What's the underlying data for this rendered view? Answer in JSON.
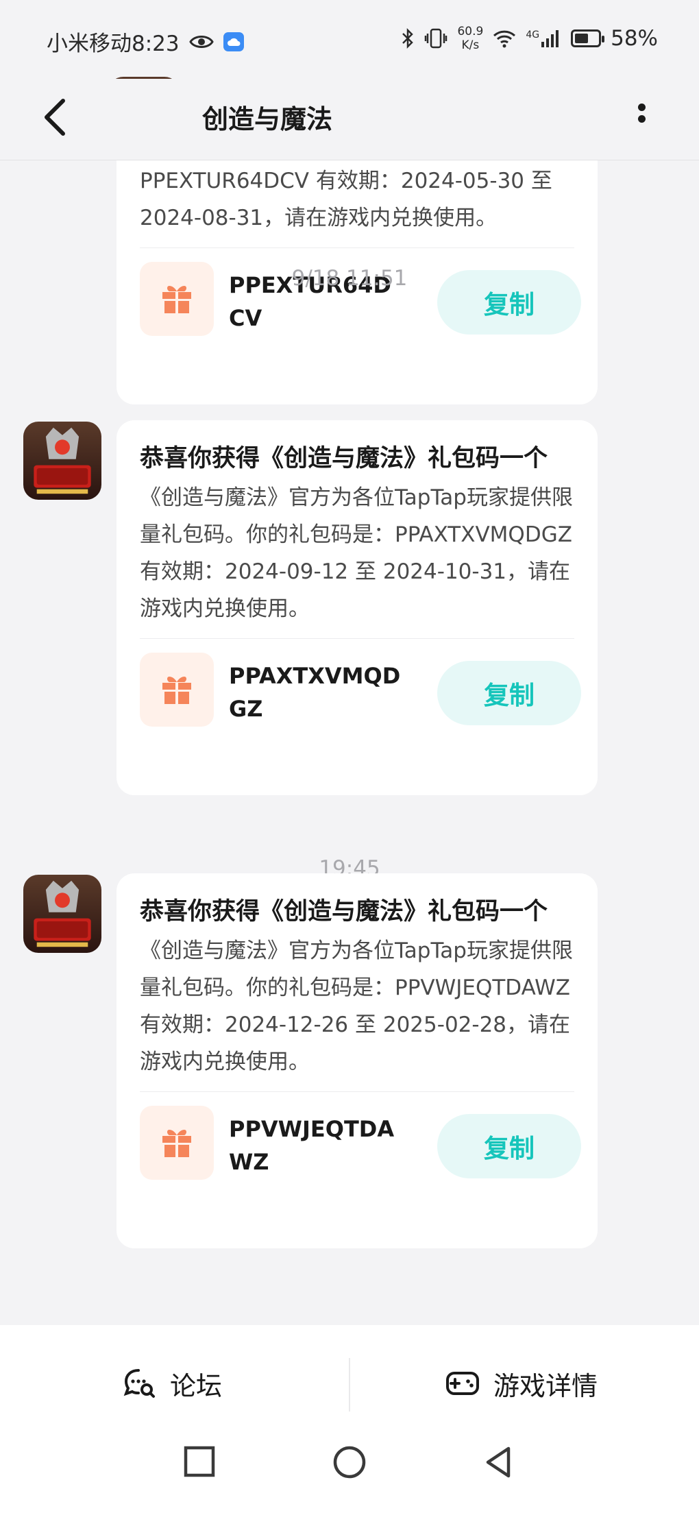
{
  "status_bar": {
    "carrier_time": "小米移动8:23",
    "speed_value": "60.9",
    "speed_unit": "K/s",
    "network": "4G",
    "battery": "58%",
    "battery_level": 0.58
  },
  "header": {
    "title": "创造与魔法"
  },
  "feed": {
    "first_card_partial": {
      "body": "PPEXTUR64DCV 有效期：2024-05-30 至 2024-08-31，请在游戏内兑换使用。",
      "code": "PPEXTUR64DCV",
      "copy_label": "复制"
    },
    "messages": [
      {
        "time": "9/18  11:51",
        "title": "恭喜你获得《创造与魔法》礼包码一个",
        "body": "《创造与魔法》官方为各位TapTap玩家提供限量礼包码。你的礼包码是：PPAXTXVMQDGZ 有效期：2024-09-12 至 2024-10-31，请在游戏内兑换使用。",
        "code": "PPAXTXVMQDGZ",
        "copy_label": "复制"
      },
      {
        "time": "19:45",
        "title": "恭喜你获得《创造与魔法》礼包码一个",
        "body": "《创造与魔法》官方为各位TapTap玩家提供限量礼包码。你的礼包码是：PPVWJEQTDAWZ 有效期：2024-12-26 至 2025-02-28，请在游戏内兑换使用。",
        "code": "PPVWJEQTDAWZ",
        "copy_label": "复制"
      }
    ]
  },
  "bottom_bar": {
    "forum_label": "论坛",
    "game_details_label": "游戏详情"
  },
  "colors": {
    "accent": "#16c5bb",
    "copy_bg": "#e6f8f7",
    "gift_orange": "#f5855a",
    "gift_bg": "#fff1ea",
    "page_bg": "#f3f3f5"
  }
}
